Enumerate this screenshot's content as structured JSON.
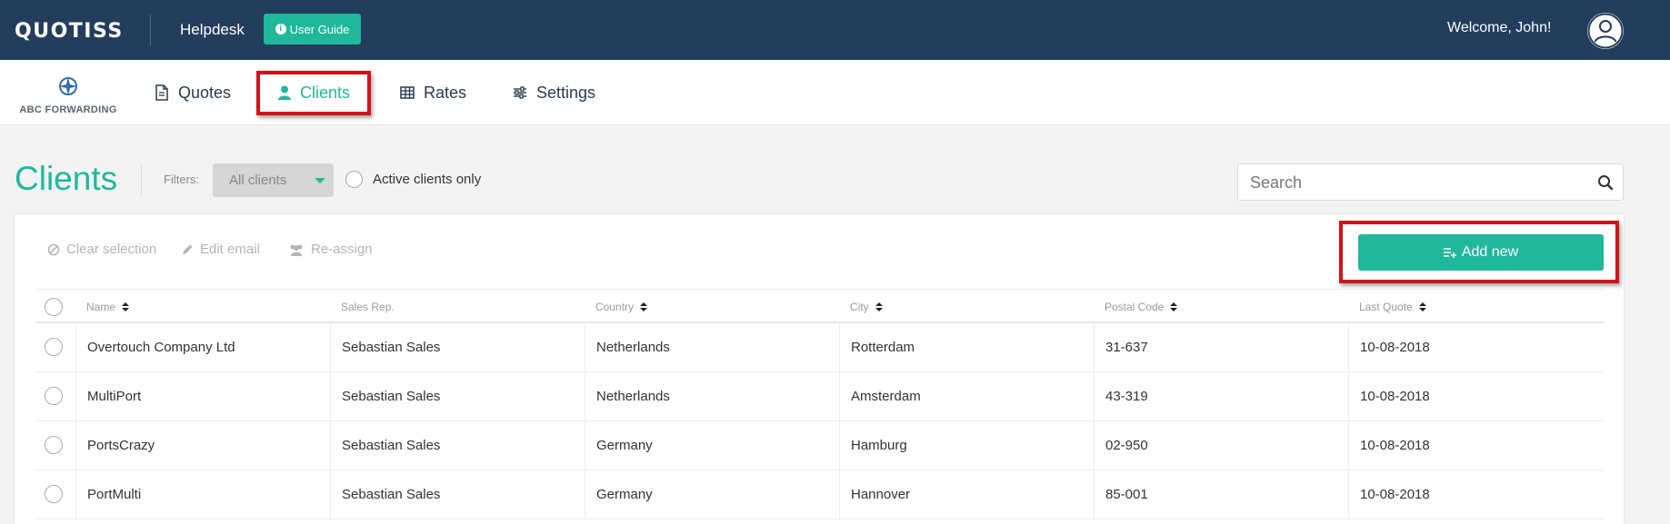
{
  "topbar": {
    "logo": "QUOTISS",
    "helpdesk_label": "Helpdesk",
    "user_guide_label": "User Guide",
    "welcome_text": "Welcome, John!"
  },
  "nav": {
    "brand_name": "ABC FORWARDING",
    "items": [
      {
        "label": "Quotes",
        "icon": "document-icon"
      },
      {
        "label": "Clients",
        "icon": "person-icon",
        "active": true
      },
      {
        "label": "Rates",
        "icon": "table-icon"
      },
      {
        "label": "Settings",
        "icon": "sliders-icon"
      }
    ]
  },
  "page": {
    "title": "Clients",
    "filters_label": "Filters:",
    "filter_selected": "All clients",
    "active_only_label": "Active clients only",
    "search_placeholder": "Search"
  },
  "actions": {
    "clear_selection": "Clear selection",
    "edit_email": "Edit email",
    "reassign": "Re-assign",
    "add_new": "Add new"
  },
  "table": {
    "headers": [
      "Name",
      "Sales Rep.",
      "Country",
      "City",
      "Postal Code",
      "Last Quote"
    ],
    "rows": [
      [
        "Overtouch Company Ltd",
        "Sebastian Sales",
        "Netherlands",
        "Rotterdam",
        "31-637",
        "10-08-2018"
      ],
      [
        "MultiPort",
        "Sebastian Sales",
        "Netherlands",
        "Amsterdam",
        "43-319",
        "10-08-2018"
      ],
      [
        "PortsCrazy",
        "Sebastian Sales",
        "Germany",
        "Hamburg",
        "02-950",
        "10-08-2018"
      ],
      [
        "PortMulti",
        "Sebastian Sales",
        "Germany",
        "Hannover",
        "85-001",
        "10-08-2018"
      ]
    ]
  },
  "colors": {
    "header_bg": "#233d5d",
    "accent": "#1fb89b",
    "highlight": "#d0121b"
  }
}
